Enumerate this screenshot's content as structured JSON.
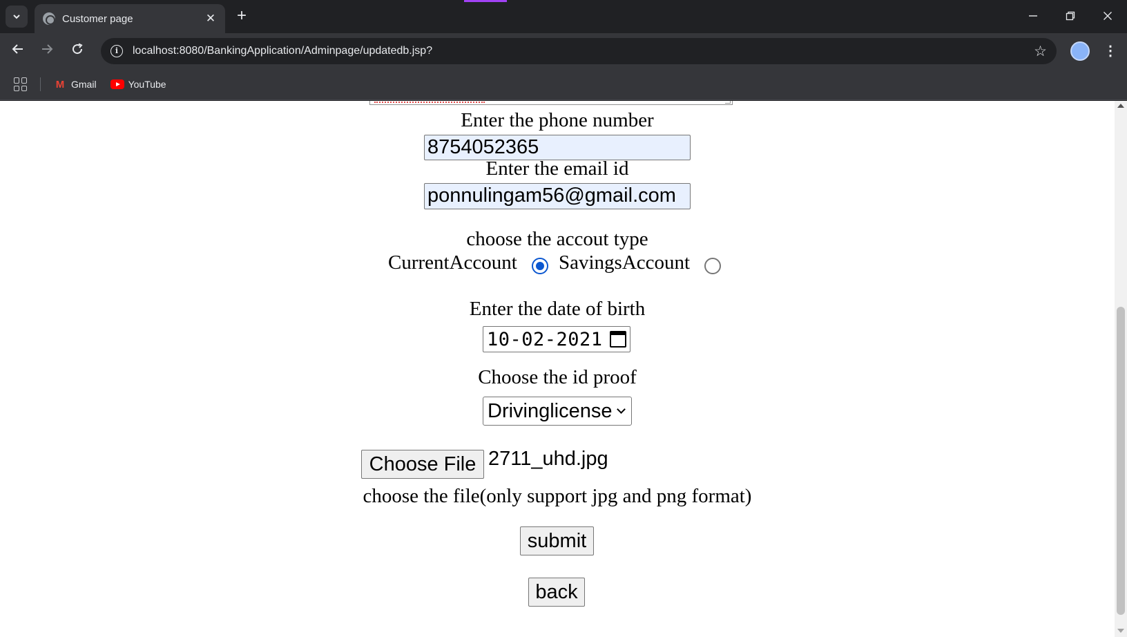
{
  "browser": {
    "tab_title": "Customer page",
    "url": "localhost:8080/BankingApplication/Adminpage/updatedb.jsp?",
    "bookmarks": [
      "Gmail",
      "YouTube"
    ]
  },
  "form": {
    "phone_label": "Enter the phone number",
    "phone_value": "8754052365",
    "email_label": "Enter the email id",
    "email_value": "ponnulingam56@gmail.com",
    "account_type_label": "choose the accout type",
    "account_options": [
      {
        "label": "CurrentAccount",
        "checked": true
      },
      {
        "label": "SavingsAccount",
        "checked": false
      }
    ],
    "dob_label": "Enter the date of birth",
    "dob_value": "10-02-2021",
    "id_proof_label": "Choose the id proof",
    "id_proof_selected": "Drivinglicense",
    "choose_file_button": "Choose File",
    "file_name": "2711_uhd.jpg",
    "file_note": "choose the file(only support jpg and png format)",
    "submit_label": "submit",
    "back_label": "back"
  },
  "colors": {
    "chrome_dark": "#202124",
    "chrome_toolbar": "#35363a",
    "autofill_bg": "#e8f0fe",
    "radio_accent": "#0b57d0"
  }
}
